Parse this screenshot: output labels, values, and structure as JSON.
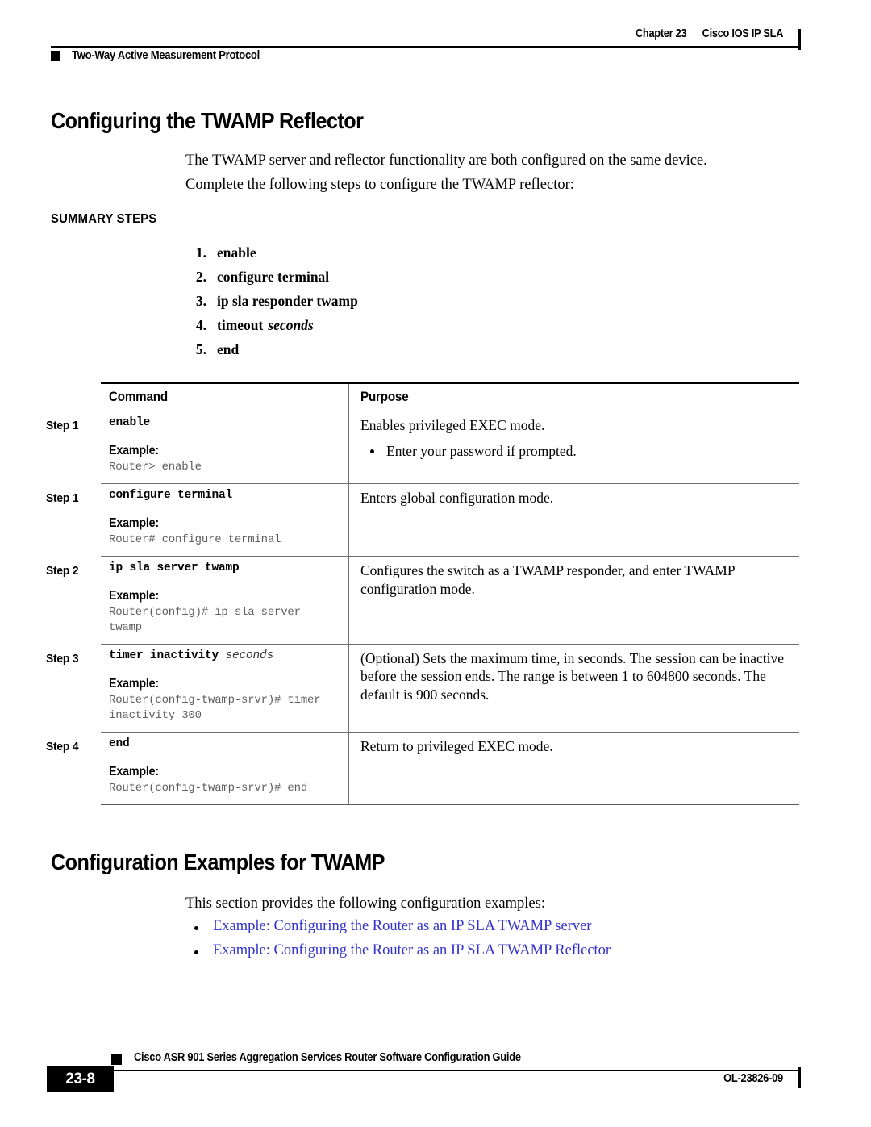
{
  "header": {
    "chapter": "Chapter 23",
    "chapter_title": "Cisco IOS IP SLA",
    "running_head": "Two-Way Active Measurement Protocol"
  },
  "section": {
    "title": "Configuring the TWAMP Reflector",
    "intro_1": "The TWAMP server and reflector functionality are both configured on the same device.",
    "intro_2": "Complete the following steps to configure the TWAMP reflector:"
  },
  "summary": {
    "label": "SUMMARY STEPS",
    "steps": [
      {
        "num": "1.",
        "cmd": "enable",
        "arg": ""
      },
      {
        "num": "2.",
        "cmd": "configure terminal",
        "arg": ""
      },
      {
        "num": "3.",
        "cmd": "ip sla responder twamp",
        "arg": ""
      },
      {
        "num": "4.",
        "cmd": "timeout",
        "arg": "seconds"
      },
      {
        "num": "5.",
        "cmd": "end",
        "arg": ""
      }
    ]
  },
  "table": {
    "col_command": "Command",
    "col_purpose": "Purpose",
    "example_label": "Example:",
    "rows": [
      {
        "step": "Step 1",
        "cmd": "enable",
        "cmd_arg": "",
        "example": "Router> enable",
        "purpose": "Enables privileged EXEC mode.",
        "bullets": [
          "Enter your password if prompted."
        ]
      },
      {
        "step": "Step 1",
        "cmd": "configure terminal",
        "cmd_arg": "",
        "example": "Router# configure terminal",
        "purpose": "Enters global configuration mode.",
        "bullets": []
      },
      {
        "step": "Step 2",
        "cmd": "ip sla server twamp",
        "cmd_arg": "",
        "example": "Router(config)# ip sla server twamp",
        "purpose": "Configures the switch as a TWAMP responder, and enter TWAMP configuration mode.",
        "bullets": []
      },
      {
        "step": "Step 3",
        "cmd": "timer inactivity",
        "cmd_arg": "seconds",
        "example": "Router(config-twamp-srvr)# timer inactivity 300",
        "purpose": "(Optional) Sets the maximum time, in seconds. The session can be inactive before the session ends. The range is between 1 to 604800 seconds. The default is 900 seconds.",
        "bullets": []
      },
      {
        "step": "Step 4",
        "cmd": "end",
        "cmd_arg": "",
        "example": "Router(config-twamp-srvr)# end",
        "purpose": "Return to privileged EXEC mode.",
        "bullets": []
      }
    ]
  },
  "examples_section": {
    "title": "Configuration Examples for TWAMP",
    "intro": "This section provides the following configuration examples:",
    "links": [
      "Example: Configuring the Router as an IP SLA TWAMP server",
      "Example: Configuring the Router as an IP SLA TWAMP Reflector"
    ],
    "link_color": "#3333cc"
  },
  "footer": {
    "guide_title": "Cisco ASR 901 Series Aggregation Services Router Software Configuration Guide",
    "page_number": "23-8",
    "doc_id": "OL-23826-09"
  }
}
